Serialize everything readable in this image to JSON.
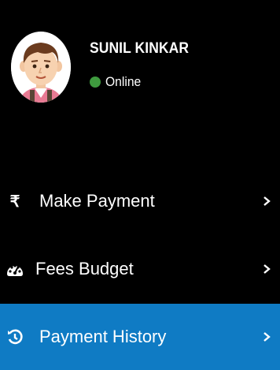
{
  "profile": {
    "name": "SUNIL KINKAR",
    "status": "Online",
    "status_color": "#3f9b3f"
  },
  "menu": {
    "active_color": "#0f7bc4",
    "items": [
      {
        "label": "Make Payment",
        "icon": "rupee-icon",
        "glyph": "₹",
        "active": false
      },
      {
        "label": "Fees Budget",
        "icon": "dashboard-gauge-icon",
        "active": false
      },
      {
        "label": "Payment History",
        "icon": "history-icon",
        "active": true
      }
    ]
  }
}
